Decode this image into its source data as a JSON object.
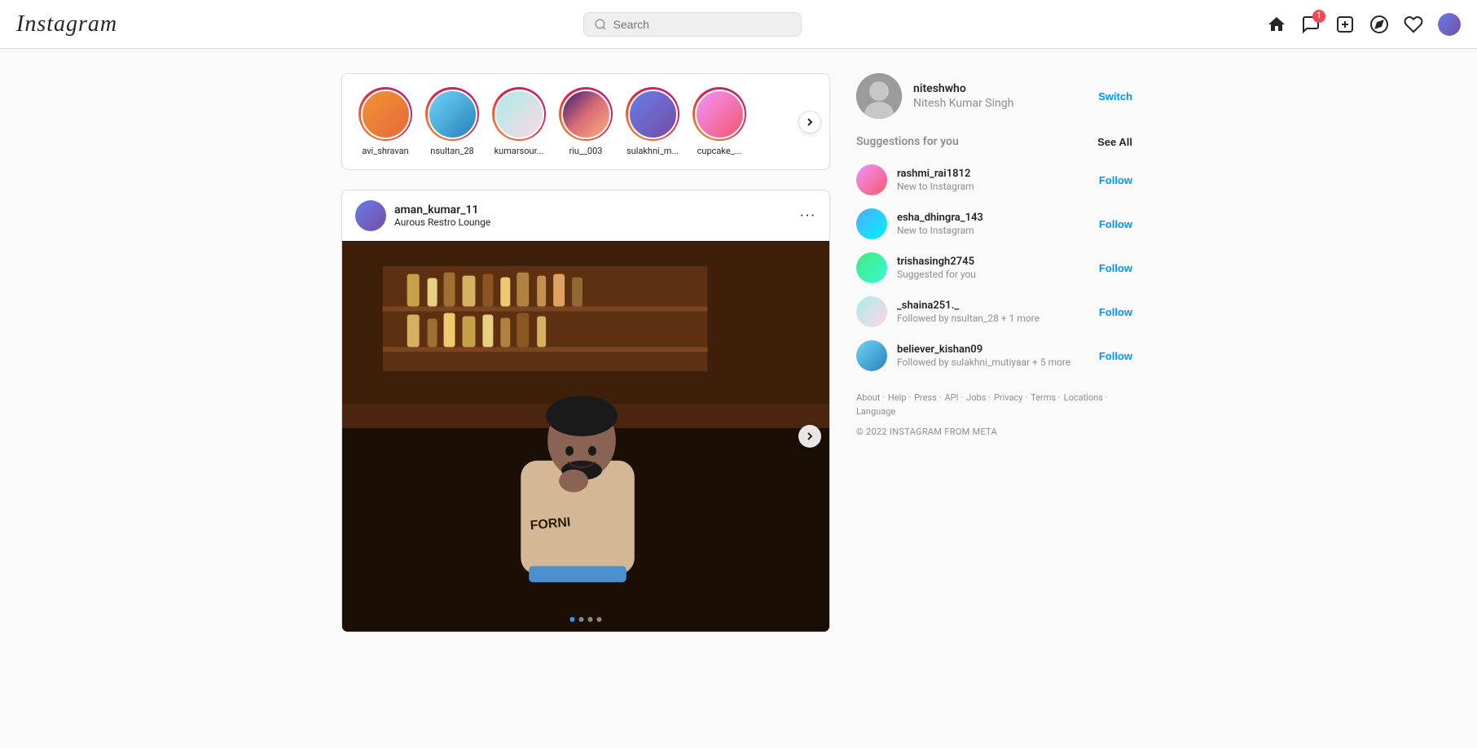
{
  "header": {
    "logo": "Instagram",
    "search_placeholder": "Search",
    "nav_icons": [
      "home",
      "messages",
      "create",
      "explore",
      "likes",
      "profile"
    ],
    "notification_count": "1"
  },
  "stories": {
    "items": [
      {
        "username": "avi_shravan",
        "color": "av1"
      },
      {
        "username": "nsultan_28",
        "color": "av2"
      },
      {
        "username": "kumarsour...",
        "color": "av3"
      },
      {
        "username": "riu__003",
        "color": "av4"
      },
      {
        "username": "sulakhni_m...",
        "color": "av5"
      },
      {
        "username": "cupcake_...",
        "color": "av6"
      }
    ]
  },
  "post": {
    "username": "aman_kumar_11",
    "location": "Aurous Restro Lounge",
    "dots": [
      true,
      false,
      false,
      false
    ],
    "active_dot": 0
  },
  "sidebar": {
    "profile": {
      "username": "niteshwho",
      "fullname": "Nitesh Kumar Singh",
      "switch_label": "Switch"
    },
    "suggestions_title": "Suggestions for you",
    "see_all_label": "See All",
    "suggestions": [
      {
        "username": "rashmi_rai1812",
        "sub": "New to Instagram",
        "follow_label": "Follow",
        "color": "av6"
      },
      {
        "username": "esha_dhingra_143",
        "sub": "New to Instagram",
        "follow_label": "Follow",
        "color": "av7"
      },
      {
        "username": "trishasingh2745",
        "sub": "Suggested for you",
        "follow_label": "Follow",
        "color": "av8"
      },
      {
        "username": "_shaina251._",
        "sub": "Followed by nsultan_28 + 1 more",
        "follow_label": "Follow",
        "color": "av3"
      },
      {
        "username": "believer_kishan09",
        "sub": "Followed by sulakhni_mutiyaar + 5 more",
        "follow_label": "Follow",
        "color": "av2"
      }
    ],
    "footer": {
      "links": [
        "About",
        "Help",
        "Press",
        "API",
        "Jobs",
        "Privacy",
        "Terms",
        "Locations",
        "Language"
      ],
      "copyright": "© 2022 INSTAGRAM FROM META"
    }
  }
}
